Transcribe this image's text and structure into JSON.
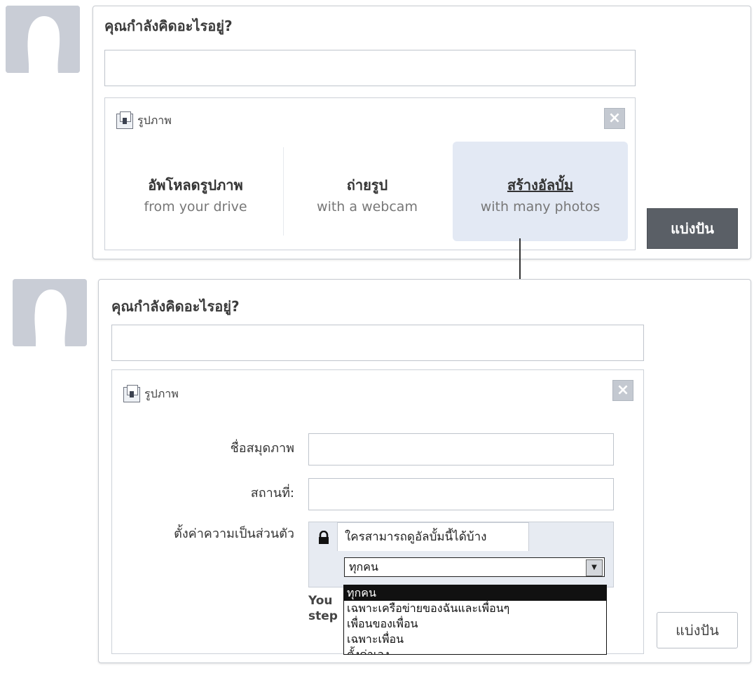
{
  "top": {
    "prompt": "คุณกำลังคิดอะไรอยู่?",
    "status_placeholder": "",
    "panel_title": "รูปภาพ",
    "options": [
      {
        "title": "อัพโหลดรูปภาพ",
        "sub": "from your drive"
      },
      {
        "title": "ถ่ายรูป",
        "sub": "with a webcam"
      },
      {
        "title": "สร้างอัลบั้ม",
        "sub": "with many photos"
      }
    ],
    "share_label": "แบ่งปัน"
  },
  "bottom": {
    "prompt": "คุณกำลังคิดอะไรอยู่?",
    "panel_title": "รูปภาพ",
    "album_name_label": "ชื่อสมุดภาพ",
    "location_label": "สถานที่:",
    "privacy_label": "ตั้งค่าความเป็นส่วนตัว",
    "privacy_question": "ใครสามารถดูอัลบั้มนี้ได้บ้าง",
    "privacy_selected": "ทุกคน",
    "privacy_options": [
      "ทุกคน",
      "เฉพาะเครือข่ายของฉันและเพื่อนๆ",
      "เพื่อนของเพื่อน",
      "เฉพาะเพื่อน",
      "ตั้งค่าเอง"
    ],
    "hint_line1": "You",
    "hint_line2": "step",
    "share_label": "แบ่งปัน"
  },
  "colors": {
    "share_dark": "#5a5f66",
    "highlight": "#e3e9f4",
    "avatar": "#c9cdd6"
  }
}
